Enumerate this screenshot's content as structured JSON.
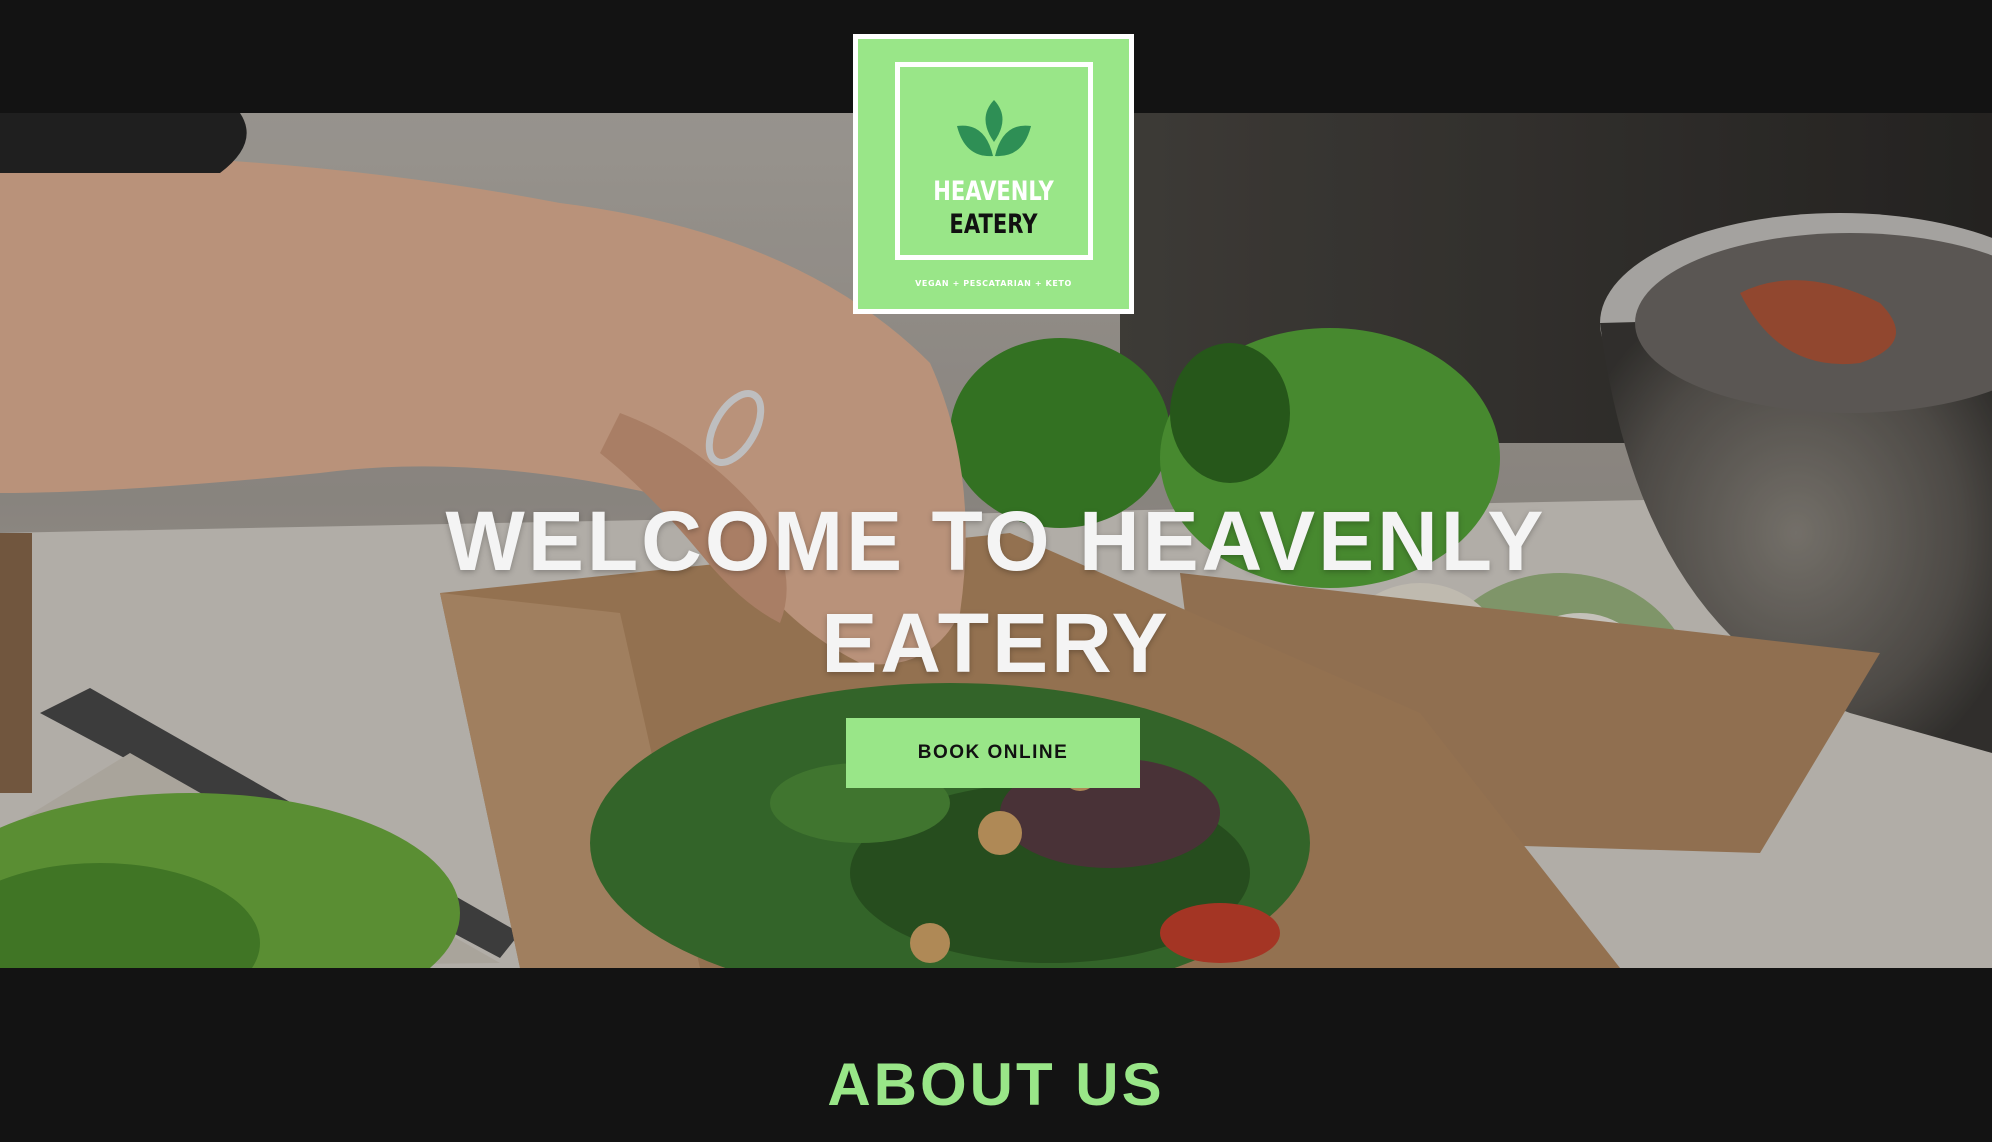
{
  "brand": {
    "name_line1": "HEAVENLY",
    "name_line2": "EATERY",
    "tagline": "VEGAN + PESCATARIAN + KETO",
    "accent_color": "#99e688",
    "icon": "leaf-icon"
  },
  "hero": {
    "title": "WELCOME TO HEAVENLY EATERY",
    "cta_label": "BOOK ONLINE"
  },
  "about": {
    "title": "ABOUT US"
  },
  "colors": {
    "background": "#131313",
    "accent": "#99e688",
    "hero_text": "#f4f4f4"
  }
}
